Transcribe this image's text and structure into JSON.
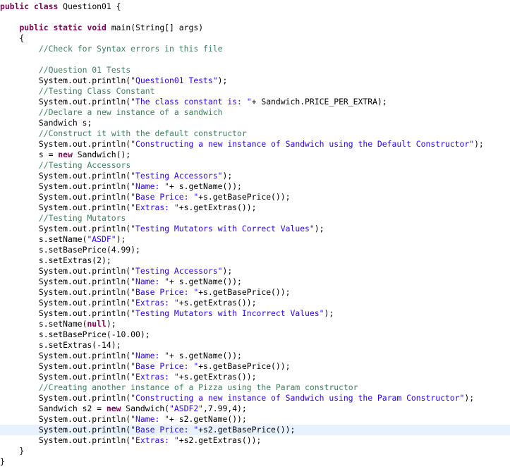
{
  "editor": {
    "language": "java",
    "current_line_index": 40,
    "colors": {
      "keyword": "#7f0055",
      "comment": "#3f7f5f",
      "string": "#2a00ff",
      "plain": "#000000",
      "current_line_highlight": "#e8f2fe"
    },
    "lines": [
      [
        [
          "kw",
          "public"
        ],
        [
          "pl",
          " "
        ],
        [
          "kw",
          "class"
        ],
        [
          "pl",
          " Question01 {"
        ]
      ],
      [],
      [
        [
          "pl",
          "    "
        ],
        [
          "kw",
          "public"
        ],
        [
          "pl",
          " "
        ],
        [
          "kw",
          "static"
        ],
        [
          "pl",
          " "
        ],
        [
          "kw",
          "void"
        ],
        [
          "pl",
          " main(String[] args)"
        ]
      ],
      [
        [
          "pl",
          "    {"
        ]
      ],
      [
        [
          "pl",
          "        "
        ],
        [
          "cm",
          "//Check for Syntax errors in this file"
        ]
      ],
      [],
      [
        [
          "pl",
          "        "
        ],
        [
          "cm",
          "//Question 01 Tests"
        ]
      ],
      [
        [
          "pl",
          "        System.out.println("
        ],
        [
          "st",
          "\"Question01 Tests\""
        ],
        [
          "pl",
          ");"
        ]
      ],
      [
        [
          "pl",
          "        "
        ],
        [
          "cm",
          "//Testing Class Constant"
        ]
      ],
      [
        [
          "pl",
          "        System.out.println("
        ],
        [
          "st",
          "\"The class constant is: \""
        ],
        [
          "pl",
          "+ Sandwich.PRICE_PER_EXTRA);"
        ]
      ],
      [
        [
          "pl",
          "        "
        ],
        [
          "cm",
          "//Declare a new instance of a sandwich"
        ]
      ],
      [
        [
          "pl",
          "        Sandwich s;"
        ]
      ],
      [
        [
          "pl",
          "        "
        ],
        [
          "cm",
          "//Construct it with the default constructor"
        ]
      ],
      [
        [
          "pl",
          "        System.out.println("
        ],
        [
          "st",
          "\"Constructing a new instance of Sandwich using the Default Constructor\""
        ],
        [
          "pl",
          ");"
        ]
      ],
      [
        [
          "pl",
          "        s = "
        ],
        [
          "kw",
          "new"
        ],
        [
          "pl",
          " Sandwich();"
        ]
      ],
      [
        [
          "pl",
          "        "
        ],
        [
          "cm",
          "//Testing Accessors"
        ]
      ],
      [
        [
          "pl",
          "        System.out.println("
        ],
        [
          "st",
          "\"Testing Accessors\""
        ],
        [
          "pl",
          ");"
        ]
      ],
      [
        [
          "pl",
          "        System.out.println("
        ],
        [
          "st",
          "\"Name: \""
        ],
        [
          "pl",
          "+ s.getName());"
        ]
      ],
      [
        [
          "pl",
          "        System.out.println("
        ],
        [
          "st",
          "\"Base Price: \""
        ],
        [
          "pl",
          "+s.getBasePrice());"
        ]
      ],
      [
        [
          "pl",
          "        System.out.println("
        ],
        [
          "st",
          "\"Extras: \""
        ],
        [
          "pl",
          "+s.getExtras());"
        ]
      ],
      [
        [
          "pl",
          "        "
        ],
        [
          "cm",
          "//Testing Mutators"
        ]
      ],
      [
        [
          "pl",
          "        System.out.println("
        ],
        [
          "st",
          "\"Testing Mutators with Correct Values\""
        ],
        [
          "pl",
          ");"
        ]
      ],
      [
        [
          "pl",
          "        s.setName("
        ],
        [
          "st",
          "\"ASDF\""
        ],
        [
          "pl",
          ");"
        ]
      ],
      [
        [
          "pl",
          "        s.setBasePrice(4.99);"
        ]
      ],
      [
        [
          "pl",
          "        s.setExtras(2);"
        ]
      ],
      [
        [
          "pl",
          "        System.out.println("
        ],
        [
          "st",
          "\"Testing Accessors\""
        ],
        [
          "pl",
          ");"
        ]
      ],
      [
        [
          "pl",
          "        System.out.println("
        ],
        [
          "st",
          "\"Name: \""
        ],
        [
          "pl",
          "+ s.getName());"
        ]
      ],
      [
        [
          "pl",
          "        System.out.println("
        ],
        [
          "st",
          "\"Base Price: \""
        ],
        [
          "pl",
          "+s.getBasePrice());"
        ]
      ],
      [
        [
          "pl",
          "        System.out.println("
        ],
        [
          "st",
          "\"Extras: \""
        ],
        [
          "pl",
          "+s.getExtras());"
        ]
      ],
      [
        [
          "pl",
          "        System.out.println("
        ],
        [
          "st",
          "\"Testing Mutators with Incorrect Values\""
        ],
        [
          "pl",
          ");"
        ]
      ],
      [
        [
          "pl",
          "        s.setName("
        ],
        [
          "kw",
          "null"
        ],
        [
          "pl",
          ");"
        ]
      ],
      [
        [
          "pl",
          "        s.setBasePrice(-10.00);"
        ]
      ],
      [
        [
          "pl",
          "        s.setExtras(-14);"
        ]
      ],
      [
        [
          "pl",
          "        System.out.println("
        ],
        [
          "st",
          "\"Name: \""
        ],
        [
          "pl",
          "+ s.getName());"
        ]
      ],
      [
        [
          "pl",
          "        System.out.println("
        ],
        [
          "st",
          "\"Base Price: \""
        ],
        [
          "pl",
          "+s.getBasePrice());"
        ]
      ],
      [
        [
          "pl",
          "        System.out.println("
        ],
        [
          "st",
          "\"Extras: \""
        ],
        [
          "pl",
          "+s.getExtras());"
        ]
      ],
      [
        [
          "pl",
          "        "
        ],
        [
          "cm",
          "//Creating another instance of a Pizza using the Param constructor"
        ]
      ],
      [
        [
          "pl",
          "        System.out.println("
        ],
        [
          "st",
          "\"Constructing a new instance of Sandwich using the Param Constructor\""
        ],
        [
          "pl",
          ");"
        ]
      ],
      [
        [
          "pl",
          "        Sandwich s2 = "
        ],
        [
          "kw",
          "new"
        ],
        [
          "pl",
          " Sandwich("
        ],
        [
          "st",
          "\"ASDF2\""
        ],
        [
          "pl",
          ",7.99,4);"
        ]
      ],
      [
        [
          "pl",
          "        System.out.println("
        ],
        [
          "st",
          "\"Name: \""
        ],
        [
          "pl",
          "+ s2.getName());"
        ]
      ],
      [
        [
          "pl",
          "        System.out.println("
        ],
        [
          "st",
          "\"Base Price: \""
        ],
        [
          "pl",
          "+s2.getBasePrice());"
        ]
      ],
      [
        [
          "pl",
          "        System.out.println("
        ],
        [
          "st",
          "\"Extras: \""
        ],
        [
          "pl",
          "+s2.getExtras());"
        ]
      ],
      [
        [
          "pl",
          "    }"
        ]
      ],
      [
        [
          "pl",
          "}"
        ]
      ]
    ]
  }
}
